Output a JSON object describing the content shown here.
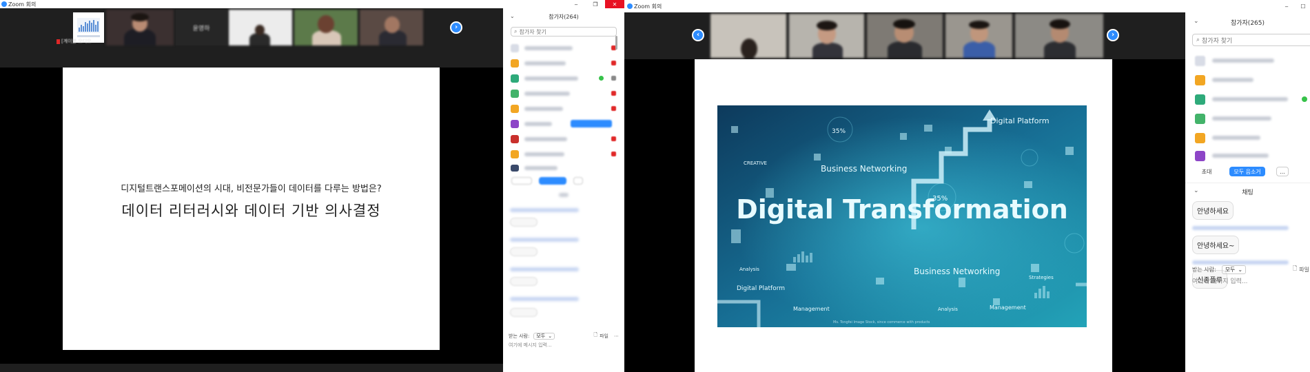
{
  "left": {
    "window_title": "Zoom 회의",
    "self_name_label": "[계이블 오디오",
    "tile_name": "윤영하",
    "panel": {
      "title": "참가자(264)",
      "search_placeholder": "참가자 찾기",
      "to_label": "받는 사람:",
      "to_value": "모두",
      "file_label": "파일",
      "message_placeholder": "여기에 메시지 입력..."
    },
    "slide": {
      "subtitle": "디지털트랜스포메이션의 시대, 비전문가들이 데이터를 다루는 방법은?",
      "title": "데이터 리터러시와 데이터 기반 의사결정"
    }
  },
  "right": {
    "window_title": "Zoom 회의",
    "panel": {
      "title": "참가자(265)",
      "search_placeholder": "참가자 찾기",
      "invite_label": "초대",
      "mute_all_label": "모두 음소거",
      "more_label": "...",
      "chat_title": "채팅",
      "messages": [
        "안녕하세요",
        "안녕하세요~",
        "신종플루"
      ],
      "to_label": "받는 사람:",
      "to_value": "모두",
      "file_label": "파일",
      "message_placeholder": "여기에 메시지 입력..."
    },
    "slide_image": {
      "headline": "Digital Transformation",
      "label_business_networking": "Business Networking",
      "label_digital_platform": "Digital Platform",
      "label_percent": "35%",
      "label_management": "Management",
      "label_analysis": "Analysis",
      "label_strategies": "Strategies",
      "label_creative": "CREATIVE",
      "label_credit": "Ms. Tongfei Image Stock, since commerce with products"
    }
  },
  "colors": {
    "zoom_blue": "#2d8cff",
    "close_red": "#e81123",
    "meeting_bg": "#1f1f1f",
    "slide_bg_dark": "#0d3a5c",
    "slide_bg_light": "#1f9ab0"
  }
}
